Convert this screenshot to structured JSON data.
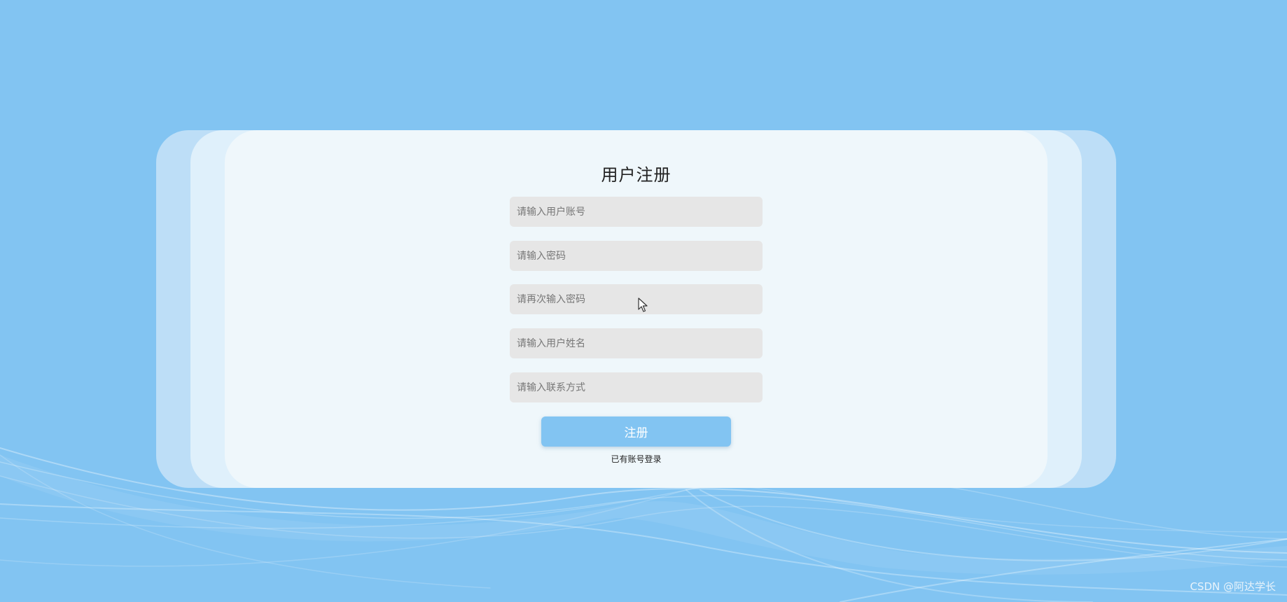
{
  "colors": {
    "background": "#82c4f2",
    "card": "#eff7fb",
    "input_background": "#e6e6e6",
    "button": "#82c4f2",
    "button_text": "#ffffff"
  },
  "form": {
    "title": "用户注册",
    "fields": [
      {
        "placeholder": "请输入用户账号",
        "value": ""
      },
      {
        "placeholder": "请输入密码",
        "value": ""
      },
      {
        "placeholder": "请再次输入密码",
        "value": ""
      },
      {
        "placeholder": "请输入用户姓名",
        "value": ""
      },
      {
        "placeholder": "请输入联系方式",
        "value": ""
      }
    ],
    "submit_label": "注册",
    "login_link": "已有账号登录"
  },
  "watermark": "CSDN @阿达学长"
}
